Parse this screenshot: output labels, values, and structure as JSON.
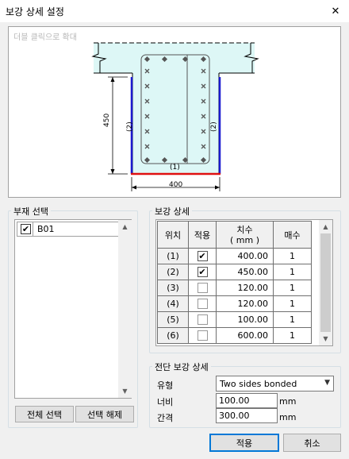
{
  "window": {
    "title": "보강 상세 설정",
    "close_icon": "✕"
  },
  "preview": {
    "hint": "더블 클릭으로 확대",
    "dim_height": "450",
    "dim_width": "400",
    "label_bottom": "(1)",
    "label_left": "(2)",
    "label_right": "(2)",
    "colors": {
      "section_fill": "#ddf7f6",
      "side_plate": "#1a1ad0",
      "bottom_plate": "#e01010"
    }
  },
  "member_select": {
    "label": "부재 선택",
    "items": [
      {
        "name": "B01",
        "checked": true
      }
    ],
    "select_all": "전체 선택",
    "deselect": "선택 해제"
  },
  "reinforce": {
    "label": "보강 상세",
    "headers": {
      "position": "위치",
      "apply": "적용",
      "size": "치수\n( mm )",
      "count": "매수"
    },
    "rows": [
      {
        "pos": "(1)",
        "apply": true,
        "size": "400.00",
        "count": "1"
      },
      {
        "pos": "(2)",
        "apply": true,
        "size": "450.00",
        "count": "1"
      },
      {
        "pos": "(3)",
        "apply": false,
        "size": "120.00",
        "count": "1"
      },
      {
        "pos": "(4)",
        "apply": false,
        "size": "120.00",
        "count": "1"
      },
      {
        "pos": "(5)",
        "apply": false,
        "size": "100.00",
        "count": "1"
      },
      {
        "pos": "(6)",
        "apply": false,
        "size": "600.00",
        "count": "1"
      }
    ]
  },
  "shear": {
    "label": "전단 보강 상세",
    "type_label": "유형",
    "type_value": "Two sides bonded",
    "width_label": "너비",
    "width_value": "100.00",
    "width_unit": "mm",
    "spacing_label": "간격",
    "spacing_value": "300.00",
    "spacing_unit": "mm"
  },
  "buttons": {
    "apply": "적용",
    "cancel": "취소"
  }
}
